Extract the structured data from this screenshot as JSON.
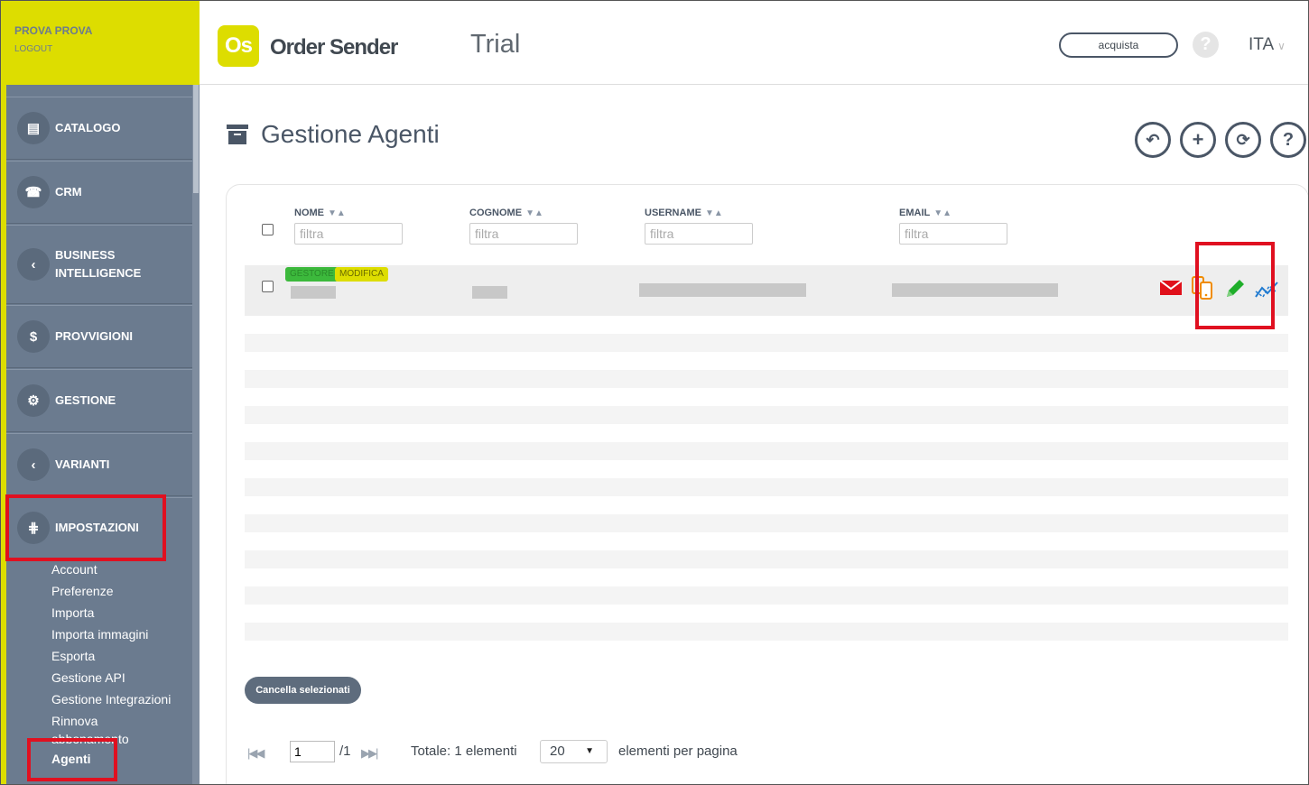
{
  "user": {
    "name": "PROVA PROVA",
    "logout": "LOGOUT"
  },
  "sidebar": {
    "items": [
      {
        "label": "CATALOGO",
        "icon": "book-icon",
        "glyph": "▤"
      },
      {
        "label": "CRM",
        "icon": "phone-icon",
        "glyph": "☎"
      },
      {
        "label": "BUSINESS INTELLIGENCE",
        "icon": "chevron-left-circle-icon",
        "glyph": "‹"
      },
      {
        "label": "PROVVIGIONI",
        "icon": "dollar-icon",
        "glyph": "$"
      },
      {
        "label": "GESTIONE",
        "icon": "gear-icon",
        "glyph": "⚙"
      },
      {
        "label": "VARIANTI",
        "icon": "chevron-left-circle-icon",
        "glyph": "‹"
      },
      {
        "label": "IMPOSTAZIONI",
        "icon": "sliders-icon",
        "glyph": "⋕"
      }
    ],
    "subitems": [
      "Account",
      "Preferenze",
      "Importa",
      "Importa immagini",
      "Esporta",
      "Gestione API",
      "Gestione Integrazioni",
      "Rinnova abbonamento",
      "Agenti"
    ]
  },
  "header": {
    "logo_badge": "Os",
    "logo_text": "Order Sender",
    "plan": "Trial",
    "acquista": "acquista",
    "help": "?",
    "language": "ITA"
  },
  "main": {
    "title": "Gestione Agenti",
    "toolbar": {
      "back": "↶",
      "add": "+",
      "refresh": "⟳",
      "help": "?"
    },
    "columns": [
      "NOME",
      "COGNOME",
      "USERNAME",
      "EMAIL"
    ],
    "filter_placeholder": "filtra",
    "row": {
      "badges": [
        "GESTORE",
        "MODIFICA"
      ]
    },
    "delete_selected": "Cancella selezionati",
    "pager": {
      "page": "1",
      "of_pages": "/1",
      "total": "Totale: 1 elementi",
      "per_page": "20",
      "per_page_label": "elementi per pagina"
    }
  },
  "colors": {
    "accent_yellow": "#dddd00",
    "sidebar": "#6b7b8f",
    "highlight_red": "#e01020",
    "badge_green": "#3cb93c",
    "mail_red": "#e0101a",
    "orange": "#f08c00",
    "edit_green": "#1fae2a",
    "chart_blue": "#1f7ad0"
  }
}
